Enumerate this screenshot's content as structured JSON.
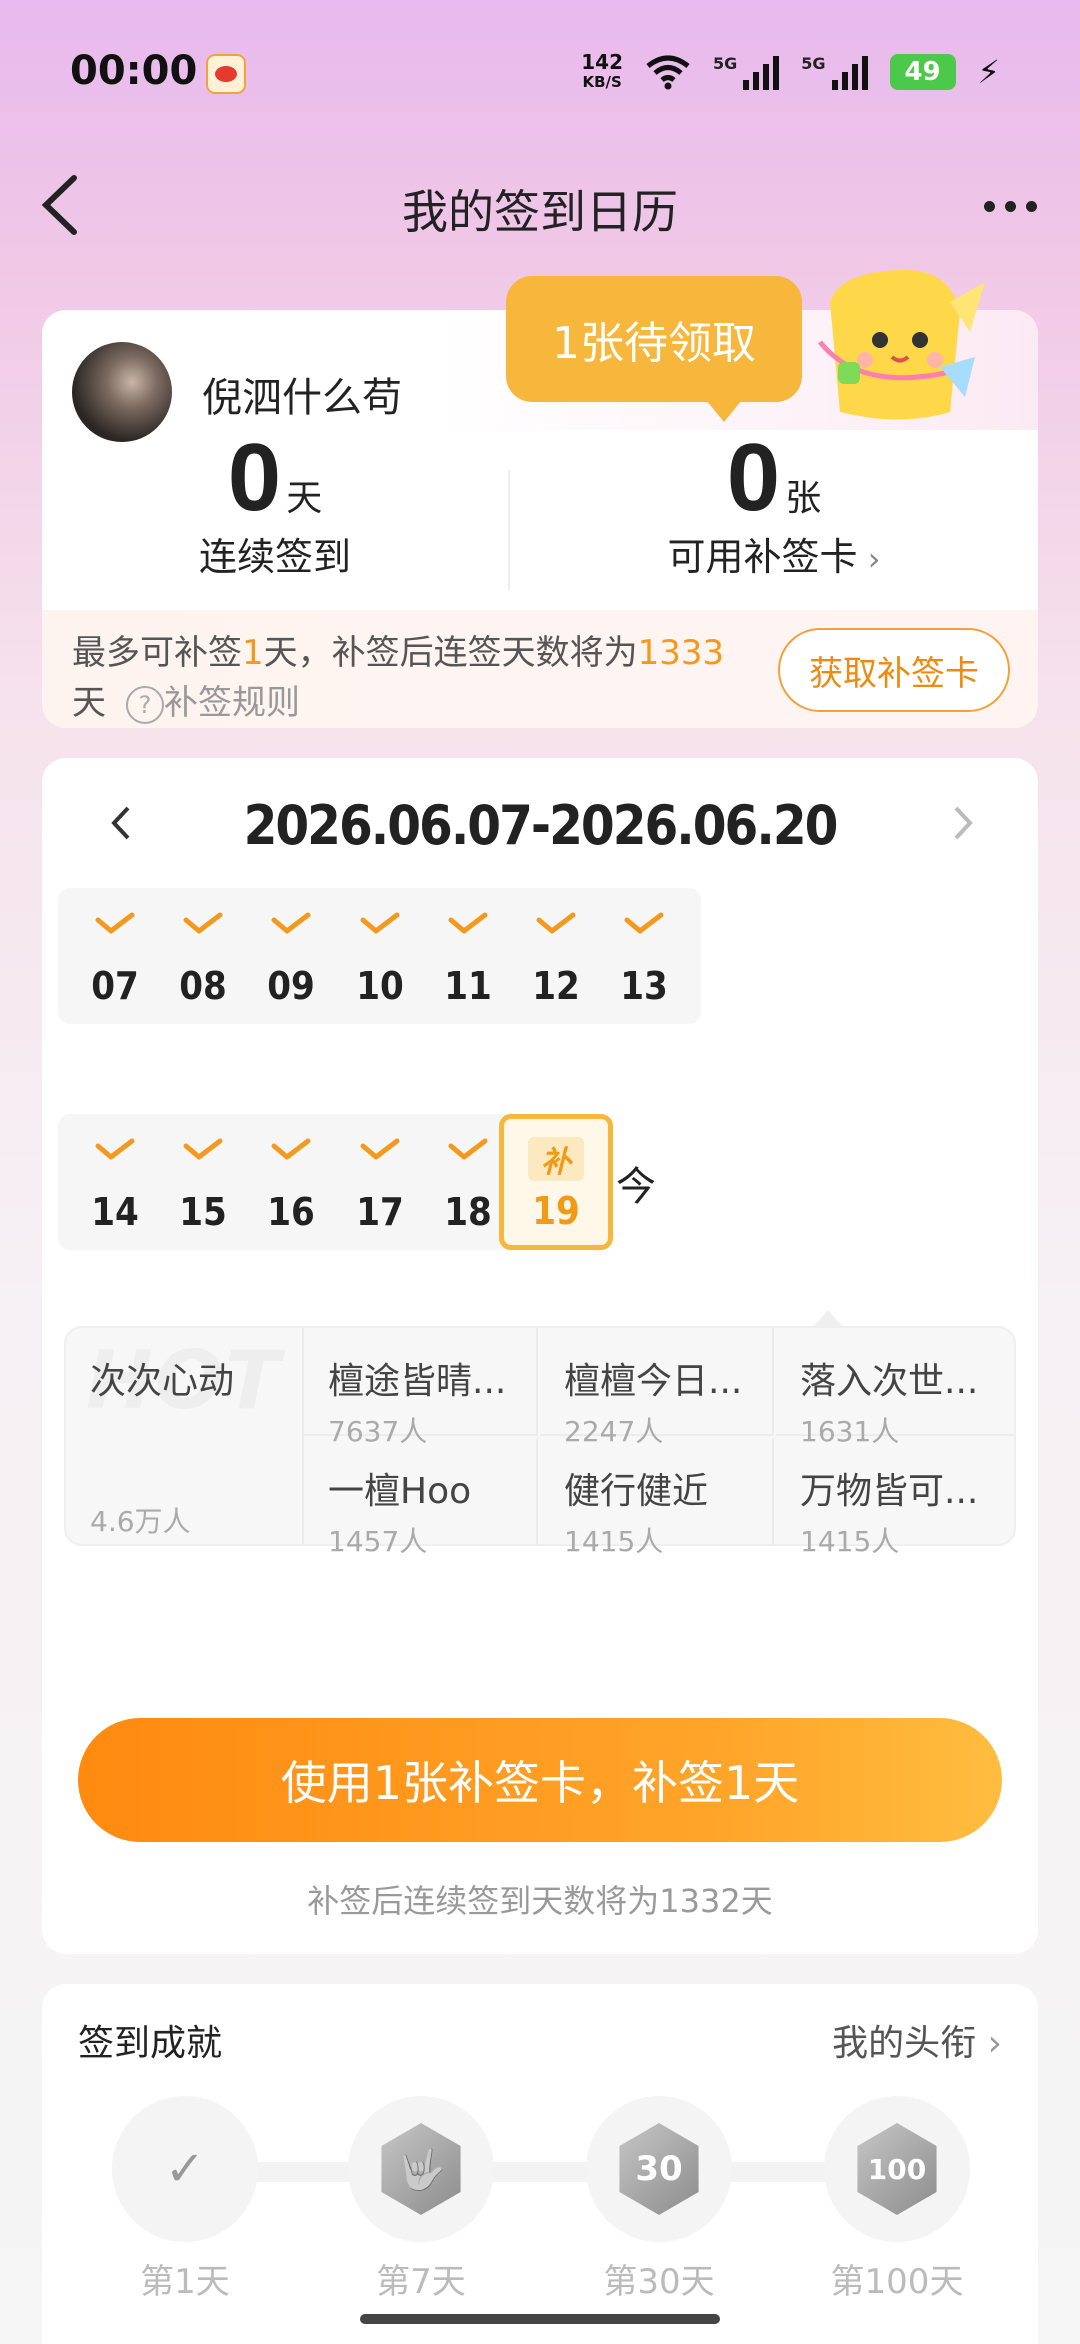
{
  "status_bar": {
    "time": "00:00",
    "net_speed_value": "142",
    "net_speed_unit": "KB/S",
    "signal_1_label": "5G",
    "signal_2_label": "5G",
    "battery": "49"
  },
  "header": {
    "title": "我的签到日历"
  },
  "profile": {
    "username": "倪泗什么苟",
    "streak_value": "0",
    "streak_unit": "天",
    "streak_label": "连续签到",
    "cards_value": "0",
    "cards_unit": "张",
    "cards_label": "可用补签卡",
    "bubble_text": "1张待领取",
    "tip_prefix": "最多可补签",
    "tip_days": "1",
    "tip_middle": "天，补签后连签天数将为",
    "tip_total": "1333",
    "tip_suffix": "天",
    "rule_label": "补签规则",
    "get_card_label": "获取补签卡"
  },
  "calendar": {
    "range": "2026.06.07-2026.06.20",
    "week1": [
      "07",
      "08",
      "09",
      "10",
      "11",
      "12",
      "13"
    ],
    "week2": [
      "14",
      "15",
      "16",
      "17",
      "18"
    ],
    "makeup_tag": "补",
    "makeup_day": "19",
    "today_label": "今"
  },
  "hot": {
    "watermark": "HOT",
    "featured_title": "次次心动",
    "featured_count": "4.6万人",
    "items": [
      {
        "title": "檀途皆晴...",
        "count": "7637人"
      },
      {
        "title": "檀檀今日...",
        "count": "2247人"
      },
      {
        "title": "落入次世...",
        "count": "1631人"
      },
      {
        "title": "一檀Hoo",
        "count": "1457人"
      },
      {
        "title": "健行健近",
        "count": "1415人"
      },
      {
        "title": "万物皆可...",
        "count": "1415人"
      }
    ]
  },
  "action": {
    "use_button_label": "使用1张补签卡，补签1天",
    "note": "补签后连续签到天数将为1332天"
  },
  "achievements": {
    "title": "签到成就",
    "link_label": "我的头衔",
    "badges": [
      {
        "label": "第1天",
        "mark": "✓"
      },
      {
        "label": "第7天",
        "mark": "🤟"
      },
      {
        "label": "第30天",
        "mark": "30"
      },
      {
        "label": "第100天",
        "mark": "100"
      }
    ]
  },
  "colors": {
    "accent": "#f6b73c",
    "button_gradient_start": "#ff8a10",
    "button_gradient_end": "#ffbd3f",
    "highlight_text": "#f39a1e"
  }
}
